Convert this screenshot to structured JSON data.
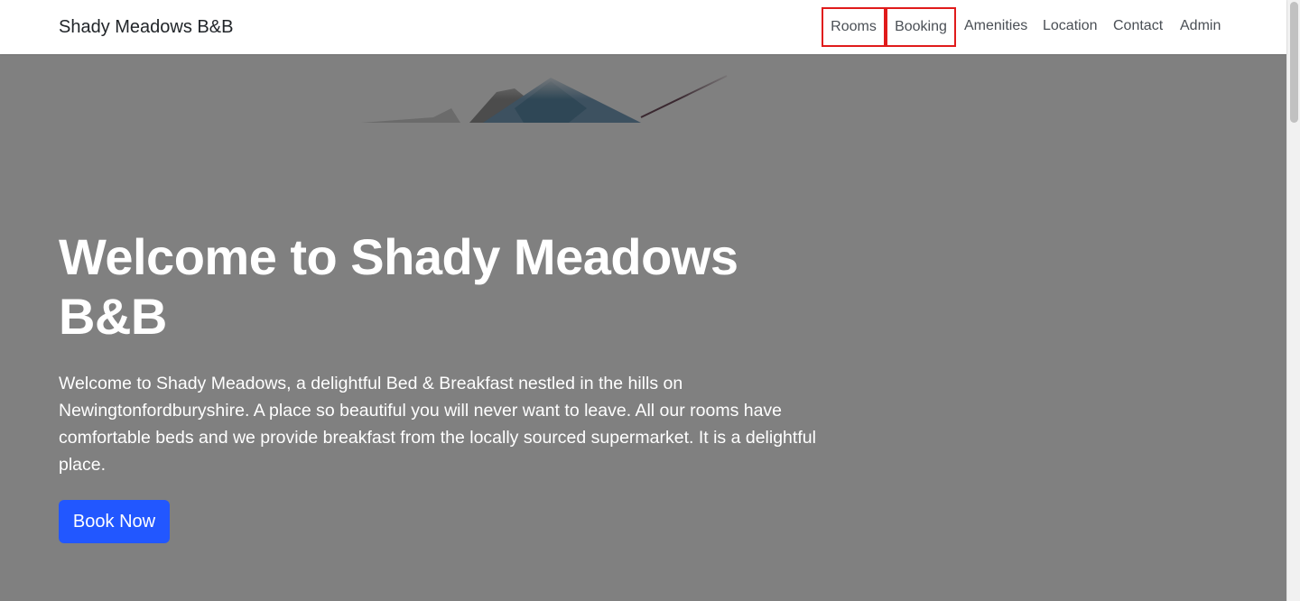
{
  "navbar": {
    "brand": "Shady Meadows B&B",
    "links": [
      {
        "label": "Rooms"
      },
      {
        "label": "Booking"
      },
      {
        "label": "Amenities"
      },
      {
        "label": "Location"
      },
      {
        "label": "Contact"
      },
      {
        "label": "Admin"
      }
    ]
  },
  "hero": {
    "title": "Welcome to Shady Meadows B&B",
    "description": "Welcome to Shady Meadows, a delightful Bed & Breakfast nestled in the hills on Newingtonfordburyshire. A place so beautiful you will never want to leave. All our rooms have comfortable beds and we provide breakfast from the locally sourced supermarket. It is a delightful place.",
    "cta_label": "Book Now"
  },
  "colors": {
    "hero_overlay": "#808080",
    "primary_button": "#2257ff",
    "highlight_border": "#e01b1b",
    "nav_background": "#ffffff"
  }
}
